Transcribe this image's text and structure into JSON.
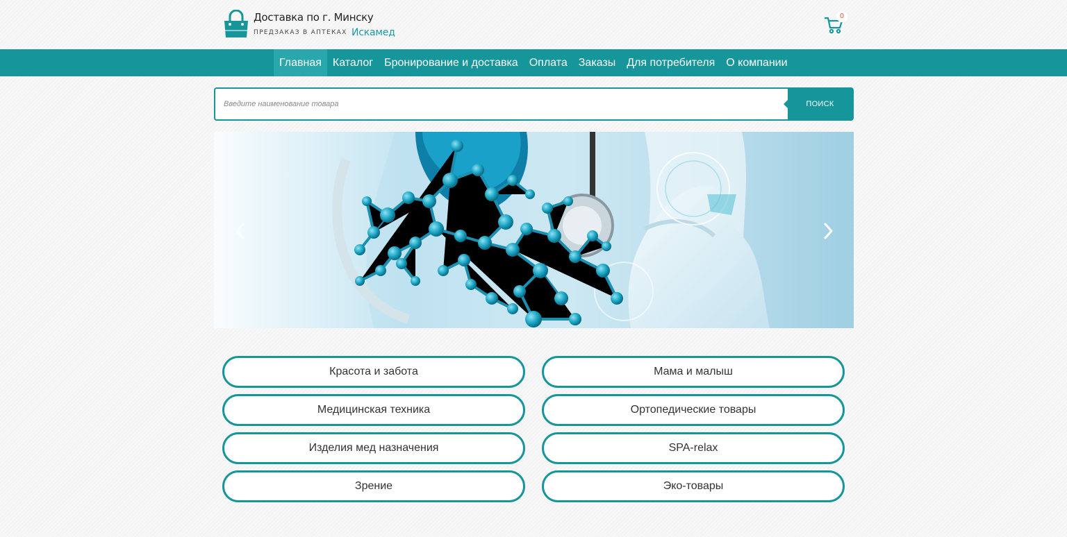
{
  "header": {
    "logo_title": "Доставка по г. Минску",
    "logo_subtitle": "ПРЕДЗАКАЗ В АПТЕКАХ",
    "logo_brand": "Искамед",
    "cart_count": "0",
    "icons": {
      "logo": "shopping-bag-icon",
      "cart": "cart-icon"
    }
  },
  "nav": {
    "items": [
      {
        "label": "Главная",
        "active": true
      },
      {
        "label": "Каталог"
      },
      {
        "label": "Бронирование и доставка"
      },
      {
        "label": "Оплата"
      },
      {
        "label": "Заказы"
      },
      {
        "label": "Для потребителя"
      },
      {
        "label": "О компании"
      }
    ]
  },
  "search": {
    "placeholder": "Введите наименование товара",
    "button_label": "ПОИСК"
  },
  "slider": {
    "prev_icon": "chevron-left-icon",
    "next_icon": "chevron-right-icon"
  },
  "categories": [
    "Красота и забота",
    "Мама и малыш",
    "Медицинская техника",
    "Ортопедические товары",
    "Изделия мед назначения",
    "SPA-relax",
    "Зрение",
    "Эко-товары"
  ],
  "colors": {
    "accent": "#16959a",
    "nav_active": "#2aa7ad",
    "cart_count": "#e8442a"
  }
}
